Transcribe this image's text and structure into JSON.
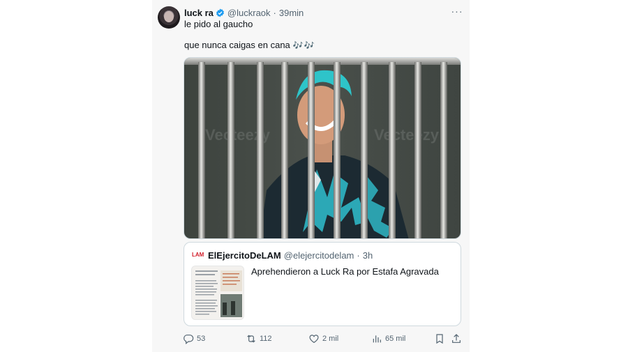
{
  "tweet": {
    "author_name": "luck ra",
    "author_handle": "@luckraok",
    "separator": "·",
    "time": "39min",
    "more_label": "···",
    "text_line1": "le pido al gaucho",
    "text_line2": "que nunca caigas en cana",
    "emoji_notes": "🎶🎶",
    "media_watermark": "Vecteezy"
  },
  "quote": {
    "logo_text": "LAM",
    "author_name": "ElEjercitoDeLAM",
    "author_handle": "@elejercitodelam",
    "separator": "·",
    "time": "3h",
    "text": "Aprehendieron a Luck Ra por Estafa Agravada"
  },
  "actions": {
    "replies": "53",
    "reposts": "112",
    "likes": "2 mil",
    "views": "65 mil"
  },
  "colors": {
    "accent": "#1d9bf0",
    "muted": "#536471",
    "hair": "#2ec4c9"
  }
}
